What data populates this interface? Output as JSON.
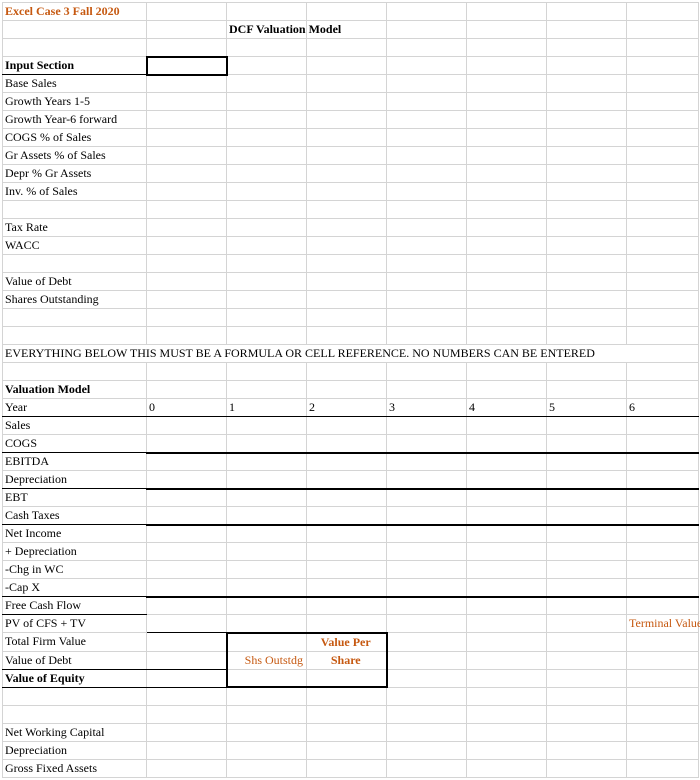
{
  "header": {
    "title": "Excel Case 3  Fall 2020",
    "model_title": "DCF Valuation Model"
  },
  "input_section": {
    "heading": "Input Section",
    "rows": [
      "Base Sales",
      "Growth Years 1-5",
      "Growth Year-6 forward",
      "COGS % of Sales",
      "Gr Assets % of Sales",
      "Depr % Gr Assets",
      "Inv. % of Sales"
    ],
    "rows2": [
      "Tax Rate",
      "WACC"
    ],
    "rows3": [
      "Value of Debt",
      "Shares Outstanding"
    ]
  },
  "note": "EVERYTHING BELOW THIS MUST BE A FORMULA OR CELL REFERENCE. NO NUMBERS CAN BE ENTERED",
  "valuation_model": {
    "heading": "Valuation Model",
    "year_label": "Year",
    "years": [
      "0",
      "1",
      "2",
      "3",
      "4",
      "5",
      "6"
    ],
    "rows": [
      "Sales",
      "COGS",
      "EBITDA",
      "Depreciation",
      "EBT",
      "Cash Taxes",
      "Net Income",
      "+ Depreciation",
      "-Chg in WC",
      "-Cap X",
      "Free Cash Flow",
      "PV of CFS + TV",
      "Total Firm Value",
      "Value of Debt",
      "Value of Equity"
    ],
    "terminal_value": "Terminal Value",
    "shs_outstdg": "Shs Outstdg",
    "value_per": "Value Per",
    "share": "Share"
  },
  "bottom": {
    "rows": [
      "Net Working Capital",
      "Depreciation",
      "Gross Fixed Assets"
    ]
  }
}
